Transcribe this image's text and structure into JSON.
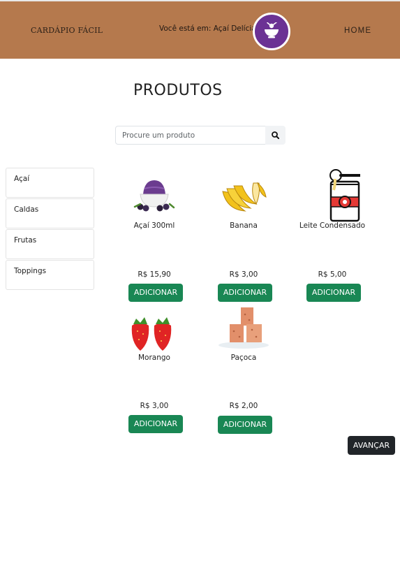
{
  "header": {
    "brand": "CARDÁPIO FÁCIL",
    "location_text": "Você está em: Açaí Delícias",
    "logo_icon": "bowl-icon",
    "logo_color": "#6b3294",
    "home_label": "HOME",
    "background_color": "#b5794d"
  },
  "main": {
    "title": "PRODUTOS"
  },
  "search": {
    "placeholder": "Procure um produto",
    "button_icon": "search-icon"
  },
  "categories": [
    {
      "label": "Açaí"
    },
    {
      "label": "Caldas"
    },
    {
      "label": "Frutas"
    },
    {
      "label": "Toppings"
    }
  ],
  "products": [
    {
      "name": "Açaí 300ml",
      "price": "R$ 15,90",
      "button": "ADICIONAR",
      "icon": "acai-bowl-icon"
    },
    {
      "name": "Banana",
      "price": "R$ 3,00",
      "button": "ADICIONAR",
      "icon": "banana-icon"
    },
    {
      "name": "Leite Condensado",
      "price": "R$ 5,00",
      "button": "ADICIONAR",
      "icon": "condensed-milk-can-icon"
    },
    {
      "name": "Morango",
      "price": "R$ 3,00",
      "button": "ADICIONAR",
      "icon": "strawberry-icon"
    },
    {
      "name": "Paçoca",
      "price": "R$ 2,00",
      "button": "ADICIONAR",
      "icon": "pacoca-icon"
    }
  ],
  "footer": {
    "next_label": "AVANÇAR"
  },
  "colors": {
    "add_button": "#198754",
    "next_button": "#212529"
  }
}
